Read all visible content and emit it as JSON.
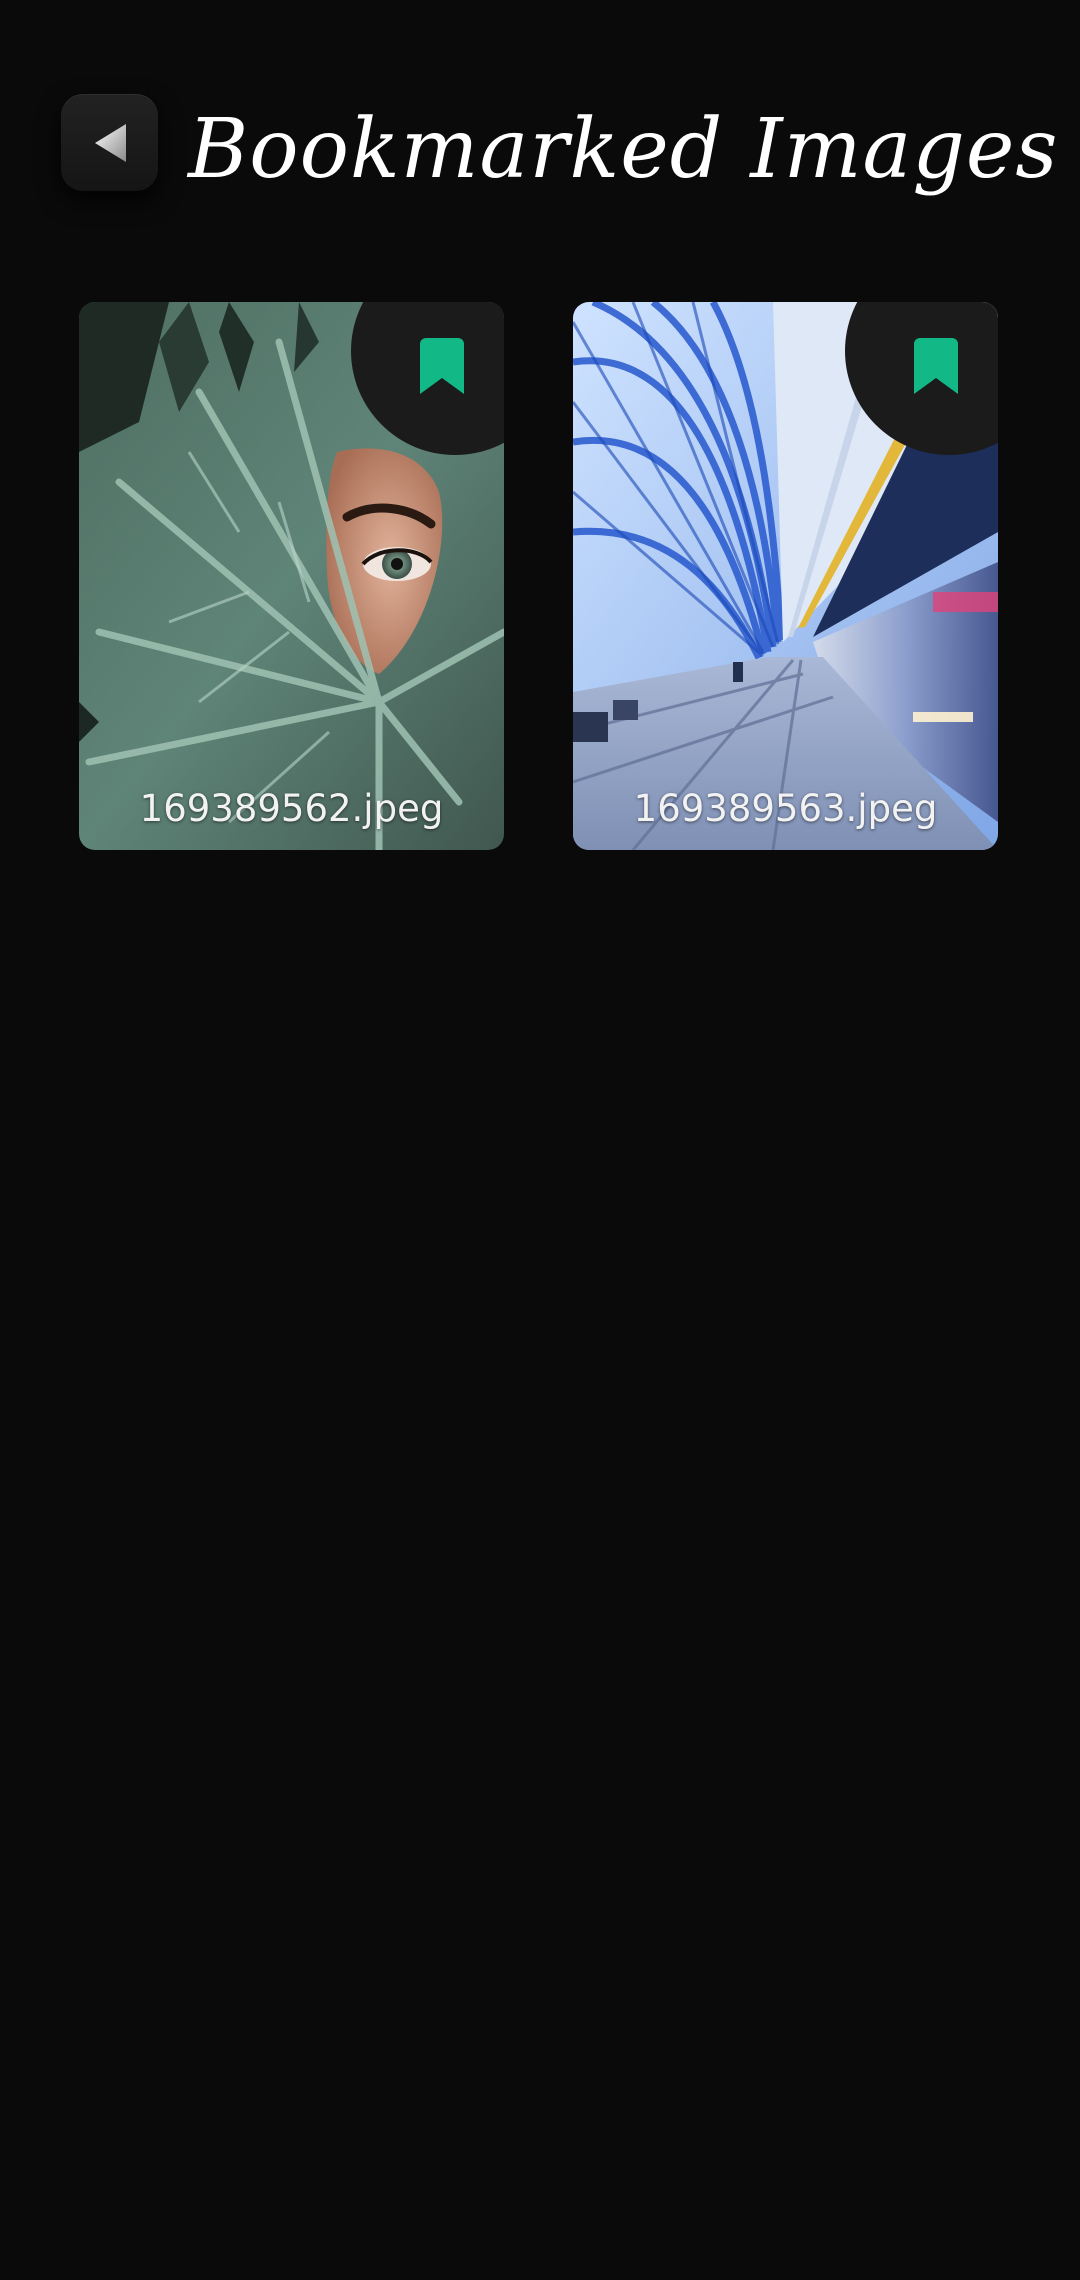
{
  "header": {
    "title": "Bookmarked Images",
    "back_icon": "back-triangle-icon"
  },
  "accent_color": "#12b886",
  "images": [
    {
      "filename": "169389562.jpeg",
      "icon": "bookmark-icon"
    },
    {
      "filename": "169389563.jpeg",
      "icon": "bookmark-icon"
    }
  ]
}
